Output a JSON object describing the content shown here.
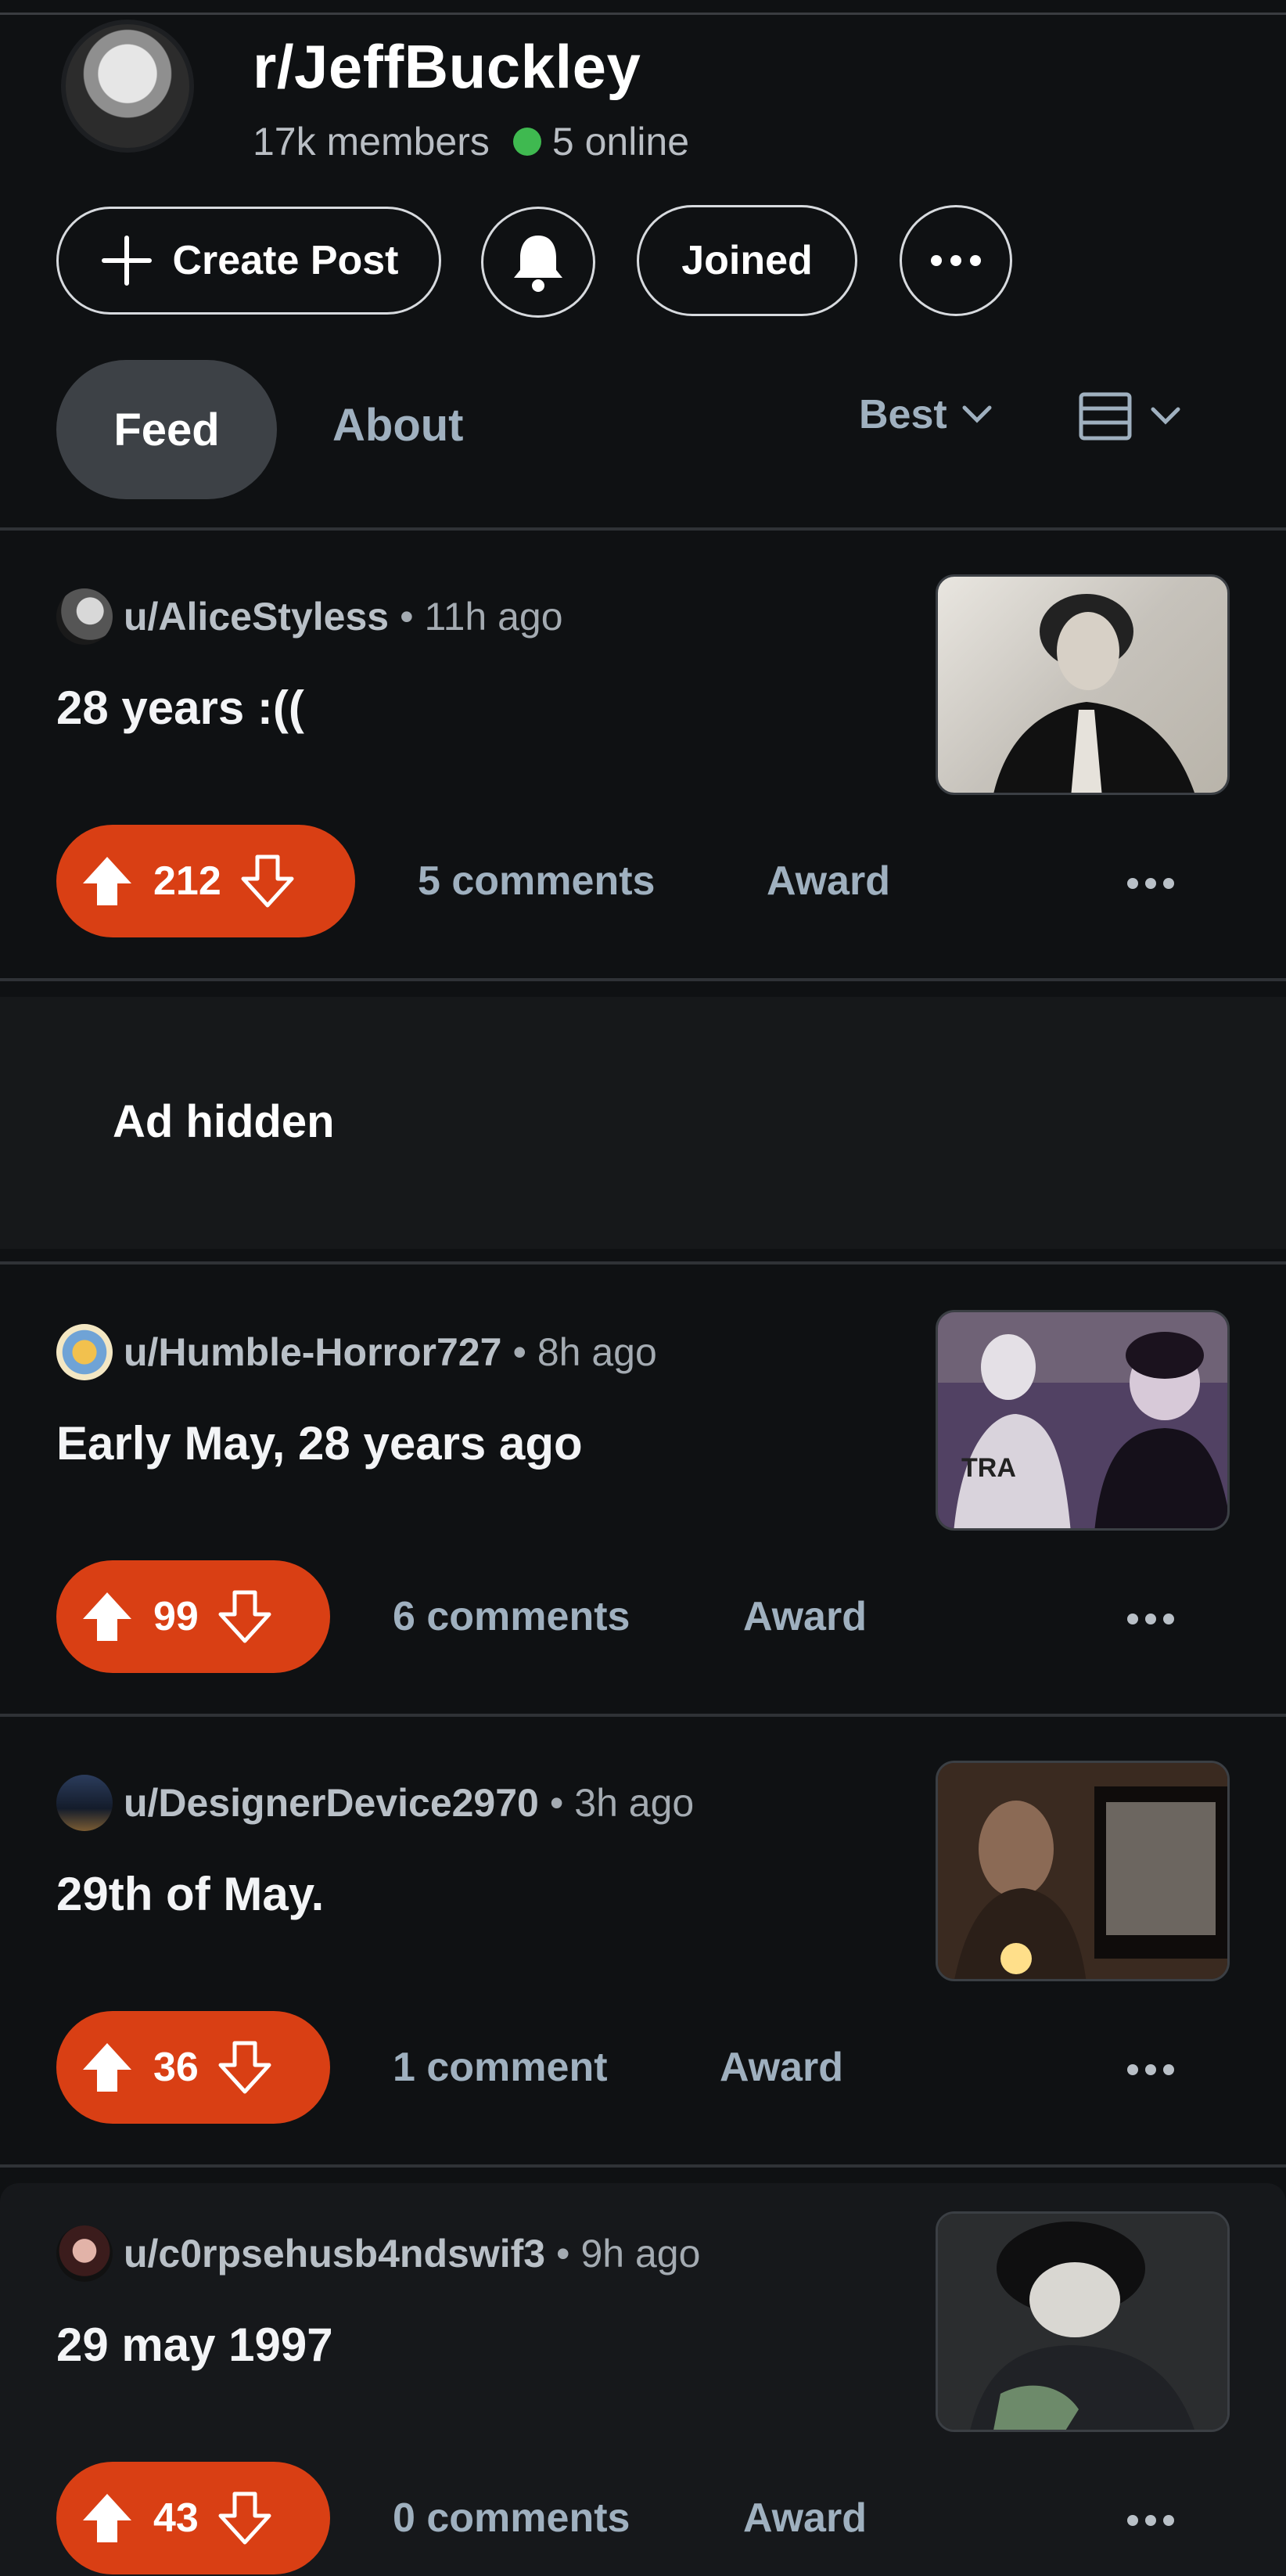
{
  "subreddit": {
    "name": "r/JeffBuckley",
    "members": "17k members",
    "online": "5 online"
  },
  "actions": {
    "create_post": "Create Post",
    "joined": "Joined"
  },
  "tabs": {
    "feed": "Feed",
    "about": "About"
  },
  "sort": {
    "label": "Best"
  },
  "colors": {
    "accent": "#d93f14",
    "online": "#3fb950",
    "background": "#0f1113"
  },
  "ad": {
    "label": "Ad hidden"
  },
  "posts": [
    {
      "author": "u/AliceStyless",
      "time": "11h ago",
      "title": "28 years :((",
      "votes": "212",
      "comments": "5 comments",
      "award": "Award"
    },
    {
      "author": "u/Humble-Horror727",
      "time": "8h ago",
      "title": "Early May, 28 years ago",
      "votes": "99",
      "comments": "6 comments",
      "award": "Award"
    },
    {
      "author": "u/DesignerDevice2970",
      "time": "3h ago",
      "title": "29th of May.",
      "votes": "36",
      "comments": "1 comment",
      "award": "Award"
    },
    {
      "author": "u/c0rpsehusb4ndswif3",
      "time": "9h ago",
      "title": "29 may 1997",
      "votes": "43",
      "comments": "0 comments",
      "award": "Award"
    }
  ]
}
